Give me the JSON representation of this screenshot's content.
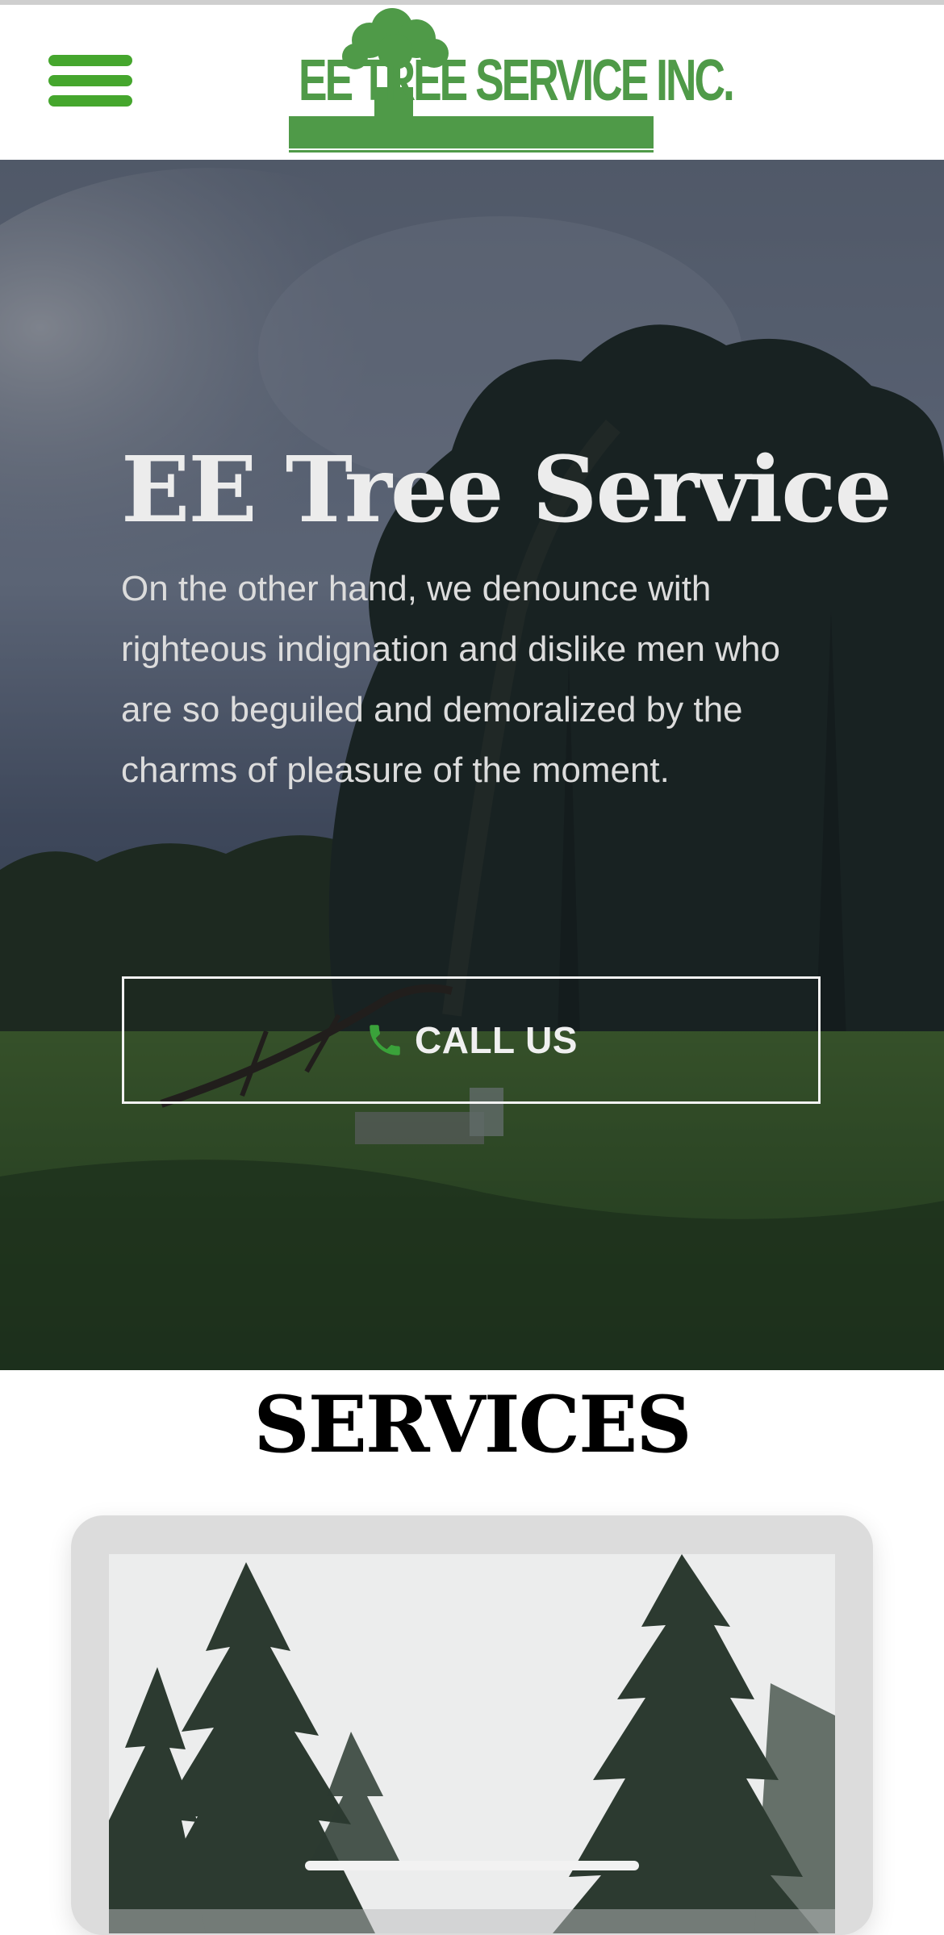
{
  "header": {
    "menu_icon": "hamburger-menu-icon",
    "logo_text": "EE TREE SERVICE INC.",
    "brand_color": "#45a62d",
    "logo_color": "#4f9a48"
  },
  "hero": {
    "title": "EE Tree Service",
    "text": "On the other hand, we denounce with righteous indignation and dislike men who are so beguiled and demoralized by the charms of pleasure of the moment.",
    "call_button": {
      "label": "CALL US",
      "icon": "phone-icon"
    }
  },
  "services": {
    "title": "SERVICES"
  }
}
